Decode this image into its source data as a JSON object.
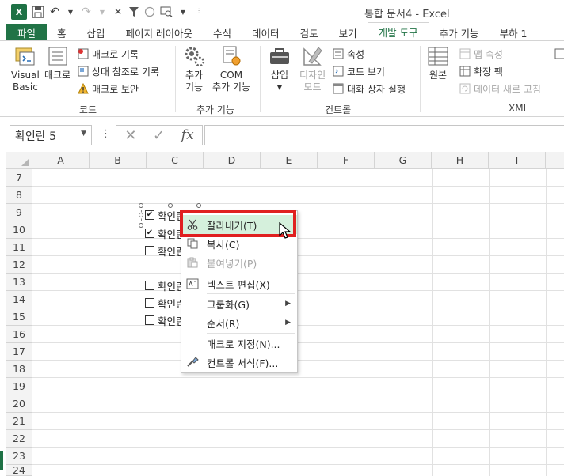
{
  "window": {
    "title": "통합 문서4 - Excel",
    "app_icon": "excel-logo"
  },
  "qat": {
    "app_letter": "X",
    "save_icon": "save-icon",
    "undo_icon": "undo-icon",
    "redo_icon": "redo-icon",
    "more_icon": "qat-more-icon"
  },
  "tabs": [
    {
      "label": "파일"
    },
    {
      "label": "홈"
    },
    {
      "label": "삽입"
    },
    {
      "label": "페이지 레이아웃"
    },
    {
      "label": "수식"
    },
    {
      "label": "데이터"
    },
    {
      "label": "검토"
    },
    {
      "label": "보기"
    },
    {
      "label": "개발 도구"
    },
    {
      "label": "추가 기능"
    },
    {
      "label": "부하 1"
    }
  ],
  "ribbon": {
    "code": {
      "label": "코드",
      "visual_basic_line1": "Visual",
      "visual_basic_line2": "Basic",
      "macro": "매크로",
      "record_macro": "매크로 기록",
      "relative_ref": "상대 참조로 기록",
      "macro_security": "매크로 보안"
    },
    "addins": {
      "label": "추가 기능",
      "addins_line1": "추가",
      "addins_line2": "기능",
      "com_line1": "COM",
      "com_line2": "추가 기능"
    },
    "controls": {
      "label": "컨트롤",
      "insert": "삽입",
      "design_line1": "디자인",
      "design_line2": "모드",
      "properties": "속성",
      "view_code": "코드 보기",
      "run_dialog": "대화 상자 실행"
    },
    "xml": {
      "label": "XML",
      "source": "원본",
      "map_properties": "맵 속성",
      "expansion_packs": "확장 팩",
      "refresh_data": "데이터 새로 고침"
    }
  },
  "formula_bar": {
    "name_box": "확인란 5",
    "more": "⋮",
    "cancel": "✕",
    "enter": "✓",
    "fx": "fx",
    "value": ""
  },
  "grid": {
    "columns": [
      "A",
      "B",
      "C",
      "D",
      "E",
      "F",
      "G",
      "H",
      "I"
    ],
    "rows": [
      "7",
      "8",
      "9",
      "10",
      "11",
      "12",
      "13",
      "14",
      "15",
      "16",
      "17",
      "18",
      "19",
      "20",
      "21",
      "22",
      "23",
      "24"
    ]
  },
  "checkboxes": [
    {
      "label": "확인란",
      "checked": "✔"
    },
    {
      "label": "확인란",
      "checked": "✔"
    },
    {
      "label": "확인란",
      "checked": ""
    },
    {
      "label": "확인란",
      "checked": ""
    },
    {
      "label": "확인란",
      "checked": ""
    },
    {
      "label": "확인란",
      "checked": ""
    }
  ],
  "context_menu": [
    {
      "label": "잘라내기(T)",
      "icon": "scissors-icon",
      "state": "hover"
    },
    {
      "label": "복사(C)",
      "icon": "copy-icon",
      "state": "normal"
    },
    {
      "label": "붙여넣기(P)",
      "icon": "paste-icon",
      "state": "disabled"
    },
    {
      "label": "텍스트 편집(X)",
      "icon": "edit-text-icon",
      "state": "normal"
    },
    {
      "label": "그룹화(G)",
      "icon": "",
      "state": "submenu"
    },
    {
      "label": "순서(R)",
      "icon": "",
      "state": "submenu"
    },
    {
      "label": "매크로 지정(N)...",
      "icon": "",
      "state": "normal"
    },
    {
      "label": "컨트롤 서식(F)...",
      "icon": "format-control-icon",
      "state": "normal"
    }
  ],
  "colors": {
    "excel_green": "#217346",
    "highlight": "#d5f0dc",
    "red_annotation": "#e02020"
  }
}
